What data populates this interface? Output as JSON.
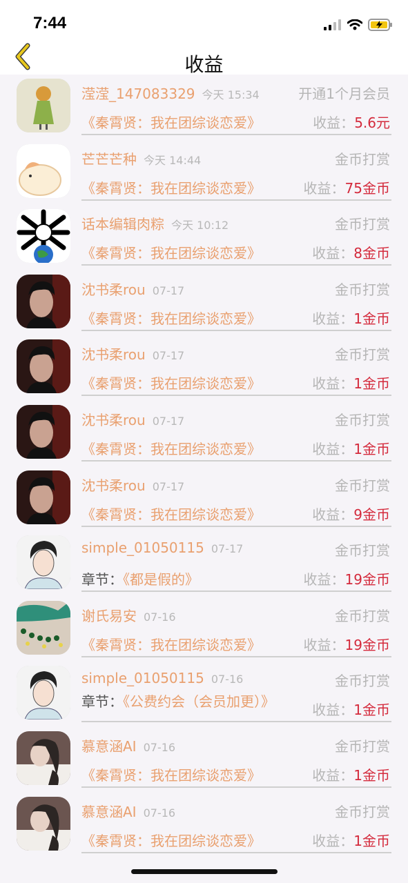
{
  "status_bar": {
    "time": "7:44"
  },
  "nav": {
    "title": "收益"
  },
  "rows": [
    {
      "name": "滢滢_147083329",
      "time": "今天 15:34",
      "type": "开通1个月会员",
      "prefix": "",
      "book": "《秦霄贤：我在团综谈恋爱》",
      "income_label": "收益：",
      "income_value": "5.6元",
      "avatar": "girl"
    },
    {
      "name": "芒芒芒种",
      "time": "今天 14:44",
      "type": "金币打赏",
      "prefix": "",
      "book": "《秦霄贤：我在团综谈恋爱》",
      "income_label": "收益：",
      "income_value": "75金币",
      "avatar": "cat"
    },
    {
      "name": "话本编辑肉粽",
      "time": "今天 10:12",
      "type": "金币打赏",
      "prefix": "",
      "book": "《秦霄贤：我在团综谈恋爱》",
      "income_label": "收益：",
      "income_value": "8金币",
      "avatar": "bones"
    },
    {
      "name": "沈书柔rou",
      "time": "07-17",
      "type": "金币打赏",
      "prefix": "",
      "book": "《秦霄贤：我在团综谈恋爱》",
      "income_label": "收益：",
      "income_value": "1金币",
      "avatar": "man"
    },
    {
      "name": "沈书柔rou",
      "time": "07-17",
      "type": "金币打赏",
      "prefix": "",
      "book": "《秦霄贤：我在团综谈恋爱》",
      "income_label": "收益：",
      "income_value": "1金币",
      "avatar": "man"
    },
    {
      "name": "沈书柔rou",
      "time": "07-17",
      "type": "金币打赏",
      "prefix": "",
      "book": "《秦霄贤：我在团综谈恋爱》",
      "income_label": "收益：",
      "income_value": "1金币",
      "avatar": "man"
    },
    {
      "name": "沈书柔rou",
      "time": "07-17",
      "type": "金币打赏",
      "prefix": "",
      "book": "《秦霄贤：我在团综谈恋爱》",
      "income_label": "收益：",
      "income_value": "9金币",
      "avatar": "man"
    },
    {
      "name": "simple_01050115",
      "time": "07-17",
      "type": "金币打赏",
      "prefix": "章节：",
      "book": "《都是假的》",
      "income_label": "收益：",
      "income_value": "19金币",
      "avatar": "drawn"
    },
    {
      "name": "谢氏易安",
      "time": "07-16",
      "type": "金币打赏",
      "prefix": "",
      "book": "《秦霄贤：我在团综谈恋爱》",
      "income_label": "收益：",
      "income_value": "19金币",
      "avatar": "beads"
    },
    {
      "name": "simple_01050115",
      "time": "07-16",
      "type": "金币打赏",
      "prefix": "章节：",
      "book": "《公费约会（会员加更）》",
      "income_label": "收益：",
      "income_value": "1金币",
      "avatar": "drawn",
      "tall": true
    },
    {
      "name": "慕意涵AI",
      "time": "07-16",
      "type": "金币打赏",
      "prefix": "",
      "book": "《秦霄贤：我在团综谈恋爱》",
      "income_label": "收益：",
      "income_value": "1金币",
      "avatar": "woman"
    },
    {
      "name": "慕意涵AI",
      "time": "07-16",
      "type": "金币打赏",
      "prefix": "",
      "book": "《秦霄贤：我在团综谈恋爱》",
      "income_label": "收益：",
      "income_value": "1金币",
      "avatar": "woman"
    }
  ],
  "colors": {
    "accent": "#e9a06f",
    "value": "#d42a3c",
    "muted": "#b5b5b5",
    "back": "#e3c21a"
  }
}
